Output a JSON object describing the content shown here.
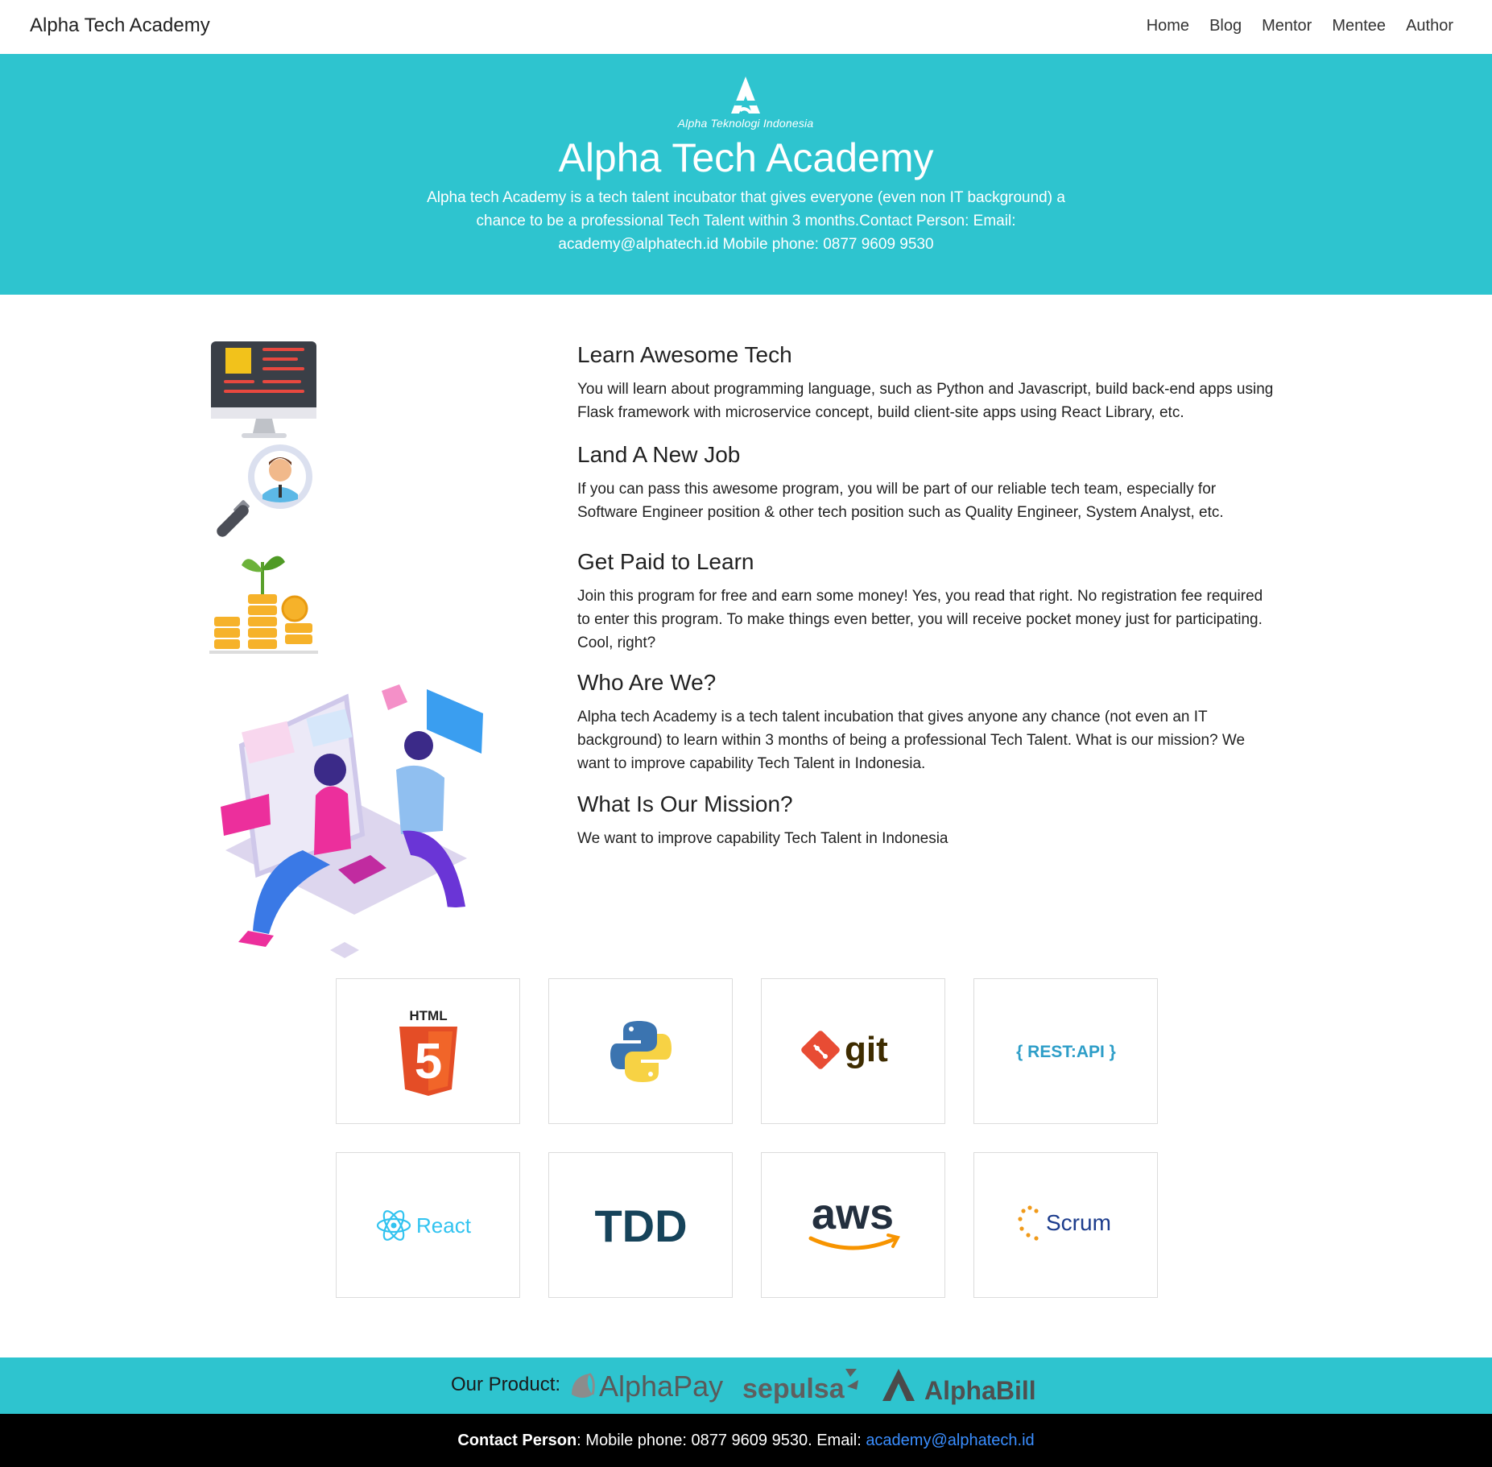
{
  "navbar": {
    "brand": "Alpha Tech Academy",
    "links": [
      "Home",
      "Blog",
      "Mentor",
      "Mentee",
      "Author"
    ]
  },
  "hero": {
    "logo_text": "Alpha Teknologi Indonesia",
    "title": "Alpha Tech Academy",
    "description": "Alpha tech Academy is a tech talent incubator that gives everyone (even non IT background) a chance to be a professional Tech Talent within 3 months.Contact Person: Email: academy@alphatech.id Mobile phone: 0877 9609 9530"
  },
  "features": [
    {
      "title": "Learn Awesome Tech",
      "text": "You will learn about programming language, such as Python and Javascript, build back-end apps using Flask framework with microservice concept, build client-site apps using React Library, etc."
    },
    {
      "title": "Land A New Job",
      "text": "If you can pass this awesome program, you will be part of our reliable tech team, especially for Software Engineer position & other tech position such as Quality Engineer, System Analyst, etc."
    },
    {
      "title": "Get Paid to Learn",
      "text": "Join this program for free and earn some money! Yes, you read that right. No registration fee required to enter this program. To make things even better, you will receive pocket money just for participating. Cool, right?"
    },
    {
      "title": "Who Are We?",
      "text": "Alpha tech Academy is a tech talent incubation that gives anyone any chance (not even an IT background) to learn within 3 months of being a professional Tech Talent. What is our mission? We want to improve capability Tech Talent in Indonesia."
    },
    {
      "title": "What Is Our Mission?",
      "text": "We want to improve capability Tech Talent in Indonesia"
    }
  ],
  "tech_logos": {
    "html": "HTML",
    "html_num": "5",
    "git": "git",
    "rest": "{ REST:API }",
    "react": "React",
    "tdd": "TDD",
    "aws": "aws",
    "scrum": "Scrum"
  },
  "products": {
    "label": "Our Product:",
    "items": [
      "AlphaPay",
      "sepulsa",
      "AlphaBill"
    ]
  },
  "contact": {
    "label": "Contact Person",
    "text": ": Mobile phone: 0877 9609 9530. Email: ",
    "email": "academy@alphatech.id"
  },
  "colors": {
    "teal": "#2ec4cf",
    "footer": "#000000",
    "link": "#3a8eff"
  }
}
